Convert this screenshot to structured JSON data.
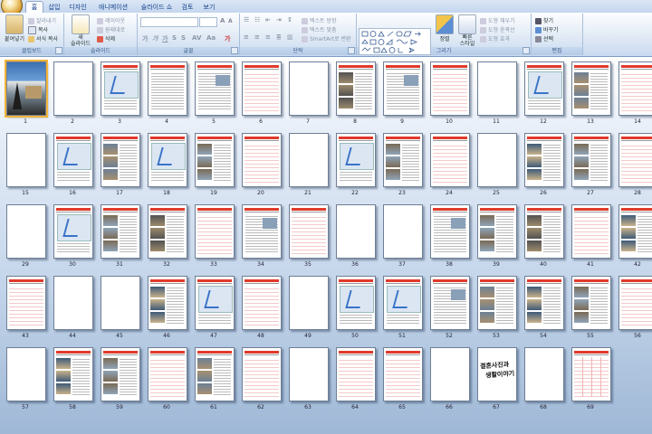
{
  "tabs": [
    "홈",
    "삽입",
    "디자인",
    "애니메이션",
    "슬라이드 쇼",
    "검토",
    "보기"
  ],
  "active_tab": 0,
  "ribbon": {
    "clipboard": {
      "label": "클립보드",
      "paste": "붙여넣기",
      "cut": "잘라내기",
      "copy": "복사",
      "format_painter": "서식 복사"
    },
    "slides": {
      "label": "슬라이드",
      "new_slide": "새\n슬라이드",
      "layout": "레이아웃",
      "reset": "원래대로",
      "delete": "삭제"
    },
    "font": {
      "label": "글꼴"
    },
    "paragraph": {
      "label": "단락",
      "text_direction": "텍스트 방향",
      "align_text": "텍스트 맞춤",
      "smartart": "SmartArt로 변환"
    },
    "drawing": {
      "label": "그리기",
      "arrange": "정렬",
      "quick_styles": "빠른\n스타일",
      "shape_fill": "도형 채우기",
      "shape_outline": "도형 윤곽선",
      "shape_effects": "도형 효과"
    },
    "editing": {
      "label": "편집",
      "find": "찾기",
      "replace": "바꾸기",
      "select": "선택"
    }
  },
  "colors": {
    "accent_red": "#e03a2b",
    "ribbon_text": "#15428b",
    "selection": "#f2b43a"
  },
  "slides": [
    {
      "n": "1",
      "t": "cover",
      "sel": true
    },
    {
      "n": "2",
      "t": "blank"
    },
    {
      "n": "3",
      "t": "map"
    },
    {
      "n": "4",
      "t": "list"
    },
    {
      "n": "5",
      "t": "textmix"
    },
    {
      "n": "6",
      "t": "pink"
    },
    {
      "n": "7",
      "t": "blank"
    },
    {
      "n": "8",
      "t": "photos"
    },
    {
      "n": "9",
      "t": "textmix"
    },
    {
      "n": "10",
      "t": "pink"
    },
    {
      "n": "11",
      "t": "blank"
    },
    {
      "n": "12",
      "t": "map"
    },
    {
      "n": "13",
      "t": "photos"
    },
    {
      "n": "14",
      "t": "pink"
    },
    {
      "n": "15",
      "t": "blank"
    },
    {
      "n": "16",
      "t": "map"
    },
    {
      "n": "17",
      "t": "photos"
    },
    {
      "n": "18",
      "t": "map"
    },
    {
      "n": "19",
      "t": "photos"
    },
    {
      "n": "20",
      "t": "pink"
    },
    {
      "n": "21",
      "t": "blank"
    },
    {
      "n": "22",
      "t": "map"
    },
    {
      "n": "23",
      "t": "photos"
    },
    {
      "n": "24",
      "t": "pink"
    },
    {
      "n": "25",
      "t": "blank"
    },
    {
      "n": "26",
      "t": "photos"
    },
    {
      "n": "27",
      "t": "photos"
    },
    {
      "n": "28",
      "t": "pink"
    },
    {
      "n": "29",
      "t": "blank"
    },
    {
      "n": "30",
      "t": "map"
    },
    {
      "n": "31",
      "t": "photos"
    },
    {
      "n": "32",
      "t": "photos"
    },
    {
      "n": "33",
      "t": "pink"
    },
    {
      "n": "34",
      "t": "textmix"
    },
    {
      "n": "35",
      "t": "pink"
    },
    {
      "n": "36",
      "t": "blank"
    },
    {
      "n": "37",
      "t": "blank"
    },
    {
      "n": "38",
      "t": "textmix"
    },
    {
      "n": "39",
      "t": "photos"
    },
    {
      "n": "40",
      "t": "photos"
    },
    {
      "n": "41",
      "t": "pink"
    },
    {
      "n": "42",
      "t": "photos"
    },
    {
      "n": "43",
      "t": "pink"
    },
    {
      "n": "44",
      "t": "blank"
    },
    {
      "n": "45",
      "t": "blank"
    },
    {
      "n": "46",
      "t": "photos"
    },
    {
      "n": "47",
      "t": "map"
    },
    {
      "n": "48",
      "t": "pink"
    },
    {
      "n": "49",
      "t": "blank"
    },
    {
      "n": "50",
      "t": "map"
    },
    {
      "n": "51",
      "t": "map"
    },
    {
      "n": "52",
      "t": "textmix"
    },
    {
      "n": "53",
      "t": "photos"
    },
    {
      "n": "54",
      "t": "photos"
    },
    {
      "n": "55",
      "t": "photos"
    },
    {
      "n": "56",
      "t": "pink"
    },
    {
      "n": "57",
      "t": "blank"
    },
    {
      "n": "58",
      "t": "photos"
    },
    {
      "n": "59",
      "t": "photos"
    },
    {
      "n": "60",
      "t": "pink"
    },
    {
      "n": "61",
      "t": "photos"
    },
    {
      "n": "62",
      "t": "pink"
    },
    {
      "n": "63",
      "t": "blank"
    },
    {
      "n": "64",
      "t": "pink"
    },
    {
      "n": "65",
      "t": "pink"
    },
    {
      "n": "66",
      "t": "blank"
    },
    {
      "n": "67",
      "t": "hand",
      "hand1": "결혼사진과",
      "hand2": "생활이야기"
    },
    {
      "n": "68",
      "t": "blank"
    },
    {
      "n": "69",
      "t": "pinkv"
    }
  ]
}
